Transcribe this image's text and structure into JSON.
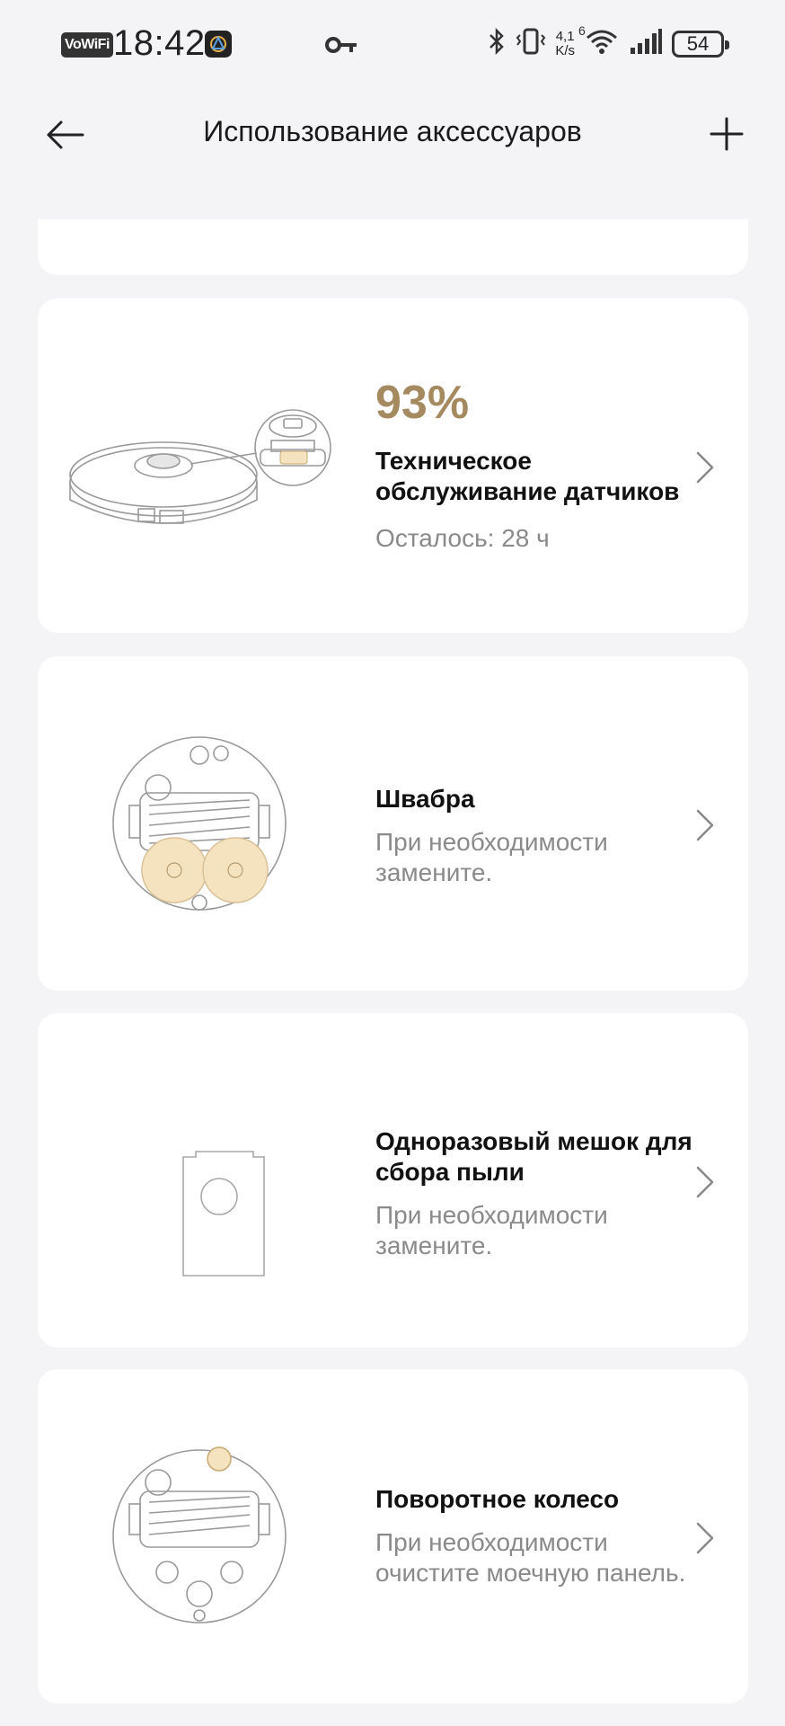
{
  "status_bar": {
    "vowifi": "VoWiFi",
    "time": "18:42",
    "speed_value": "4,1",
    "speed_unit": "K/s",
    "network": "6",
    "battery": "54"
  },
  "header": {
    "title": "Использование аксессуаров"
  },
  "accessories": [
    {
      "percent": "93%",
      "name": "Техническое обслуживание датчиков",
      "subtitle": "Осталось: 28 ч"
    },
    {
      "name": "Швабра",
      "subtitle": "При необходимости замените."
    },
    {
      "name": "Одноразовый мешок для сбора пыли",
      "subtitle": "При необходимости замените."
    },
    {
      "name": "Поворотное колесо",
      "subtitle": "При необходимости очистите моечную панель."
    }
  ],
  "colors": {
    "accent": "#a58a5f",
    "highlight": "#f5e3bf",
    "background": "#f4f3f6"
  }
}
